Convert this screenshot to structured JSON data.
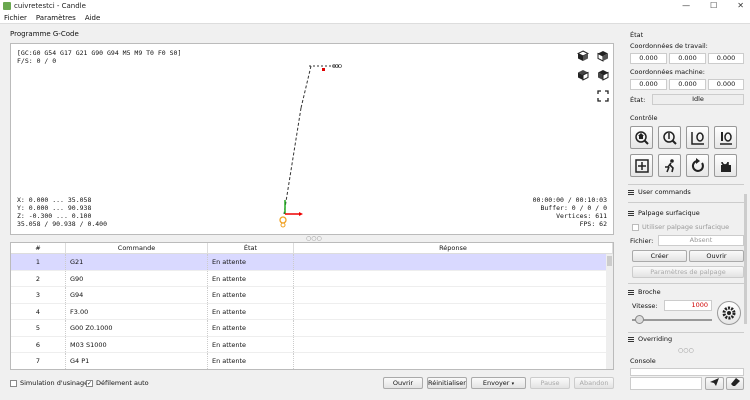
{
  "window": {
    "title": "cuivretestci - Candle",
    "controls": [
      "—",
      "☐",
      "✕"
    ]
  },
  "menu": [
    "Fichier",
    "Paramètres",
    "Aide"
  ],
  "program_label": "Programme G-Code",
  "viewer": {
    "gcode_state": "[GC:G0 G54 G17 G21 G90 G94 M5 M9 T0 F0 S0]",
    "feed_speed": "F/S: 0 / 0",
    "ranges": [
      "X: 0.000 ... 35.058",
      "Y: 0.000 ... 90.938",
      "Z: -0.300 ... 0.100",
      "35.058 / 90.938 / 0.400"
    ],
    "stats": [
      "00:00:00 / 00:10:03",
      "Buffer: 0 / 0 / 0",
      "Vertices: 611",
      "FPS: 62"
    ]
  },
  "table": {
    "headers": [
      "#",
      "Commande",
      "État",
      "Réponse"
    ],
    "rows": [
      {
        "n": "1",
        "cmd": "G21",
        "state": "En attente",
        "resp": ""
      },
      {
        "n": "2",
        "cmd": "G90",
        "state": "En attente",
        "resp": ""
      },
      {
        "n": "3",
        "cmd": "G94",
        "state": "En attente",
        "resp": ""
      },
      {
        "n": "4",
        "cmd": "F3.00",
        "state": "En attente",
        "resp": ""
      },
      {
        "n": "5",
        "cmd": "G00 Z0.1000",
        "state": "En attente",
        "resp": ""
      },
      {
        "n": "6",
        "cmd": "M03 S1000",
        "state": "En attente",
        "resp": ""
      },
      {
        "n": "7",
        "cmd": "G4 P1",
        "state": "En attente",
        "resp": ""
      }
    ]
  },
  "bottom": {
    "simulation": "Simulation d'usinage",
    "autoscroll": "Défilement auto",
    "open": "Ouvrir",
    "reset": "Réinitialiser",
    "send": "Envoyer",
    "pause": "Pause",
    "abort": "Abandon"
  },
  "right": {
    "state_title": "État",
    "work_coords_label": "Coordonnées de travail:",
    "work_coords": [
      "0.000",
      "0.000",
      "0.000"
    ],
    "machine_coords_label": "Coordonnées machine:",
    "machine_coords": [
      "0.000",
      "0.000",
      "0.000"
    ],
    "status_label": "État:",
    "status_value": "Idle",
    "control_title": "Contrôle",
    "user_commands": "User commands",
    "probing_title": "Palpage surfacique",
    "use_probing": "Utiliser palpage surfacique",
    "file_label": "Fichier:",
    "file_value": "Absent",
    "create": "Créer",
    "open": "Ouvrir",
    "probing_params": "Paramètres de palpage",
    "spindle_title": "Broche",
    "speed_label": "Vitesse:",
    "speed_value": "1000",
    "overriding": "Overriding",
    "console": "Console"
  },
  "colors": {
    "selected_row": "#d9d9ff",
    "spindle_value": "#d00000",
    "toolpath_red": "#e00000",
    "tool_orange": "#f0a020"
  }
}
